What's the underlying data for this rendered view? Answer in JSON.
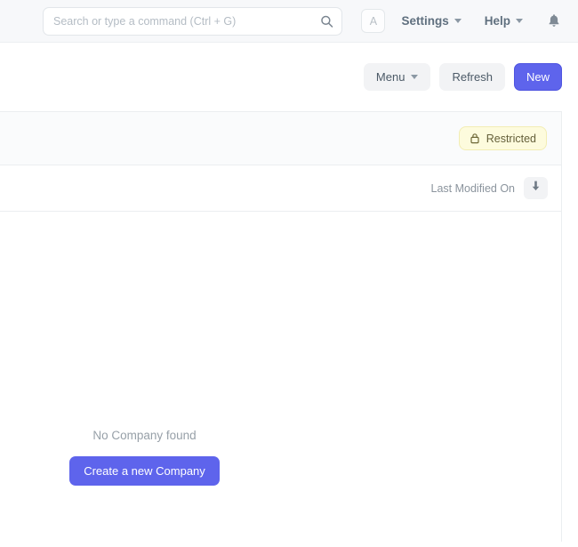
{
  "navbar": {
    "search": {
      "placeholder": "Search or type a command (Ctrl + G)",
      "value": "",
      "icon": "search-icon"
    },
    "avatar_letter": "A",
    "settings_label": "Settings",
    "help_label": "Help",
    "notifications_icon": "bell-icon"
  },
  "page_actions": {
    "menu_label": "Menu",
    "refresh_label": "Refresh",
    "new_label": "New"
  },
  "list": {
    "restricted_badge": {
      "label": "Restricted",
      "icon": "lock-icon"
    },
    "sort": {
      "field_label": "Last Modified On",
      "direction_icon": "arrow-down-icon"
    },
    "empty_state": {
      "message": "No Company found",
      "create_label": "Create a new Company"
    }
  },
  "colors": {
    "primary": "#5e64ec",
    "navbar_bg": "#f7f8fa",
    "badge_bg": "#fdfbdd",
    "badge_border": "#f2edb4",
    "muted_text": "#8b949d"
  }
}
